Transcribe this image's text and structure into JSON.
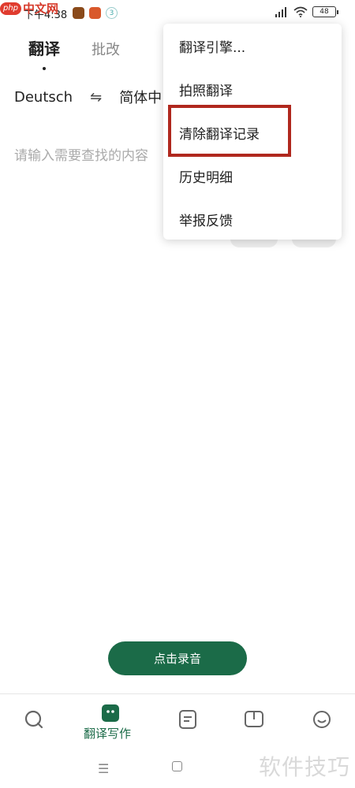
{
  "status_bar": {
    "time": "下午4:38",
    "battery": "48",
    "notif_c": "3"
  },
  "watermark": {
    "logo": "php",
    "text": "中文网"
  },
  "tabs": [
    {
      "label": "翻译",
      "active": true
    },
    {
      "label": "批改",
      "active": false
    }
  ],
  "language": {
    "source": "Deutsch",
    "swap": "⇋",
    "target": "简体中"
  },
  "input": {
    "placeholder": "请输入需要查找的内容"
  },
  "menu": {
    "items": [
      {
        "label": "翻译引擎..."
      },
      {
        "label": "拍照翻译"
      },
      {
        "label": "清除翻译记录"
      },
      {
        "label": "历史明细"
      },
      {
        "label": "举报反馈"
      }
    ]
  },
  "record_button": {
    "label": "点击录音"
  },
  "bottom_nav": {
    "active_label": "翻译写作",
    "colors": {
      "active": "#1b6b48",
      "inactive": "#666666"
    }
  },
  "system_watermark": {
    "text": "软件技巧"
  },
  "colors": {
    "accent": "#1b6b48",
    "highlight_box": "#b0281e"
  }
}
